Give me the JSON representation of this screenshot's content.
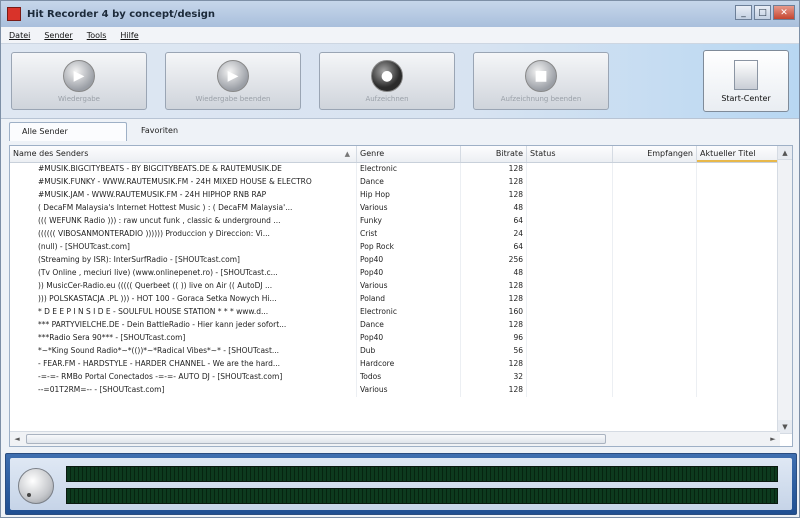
{
  "window": {
    "title": "Hit Recorder 4 by concept/design"
  },
  "window_buttons": {
    "minimize": "_",
    "maximize": "□",
    "close": "✕"
  },
  "menu": [
    "Datei",
    "Sender",
    "Tools",
    "Hilfe"
  ],
  "toolbar": {
    "play_label": "Wiedergabe",
    "stop_play_label": "Wiedergabe beenden",
    "record_label": "Aufzeichnen",
    "stop_record_label": "Aufzeichnung beenden",
    "start_center_label": "Start-Center"
  },
  "tabs": [
    "Alle Sender",
    "Favoriten"
  ],
  "columns": {
    "name": "Name des Senders",
    "genre": "Genre",
    "bitrate": "Bitrate",
    "status": "Status",
    "received": "Empfangen",
    "current_title": "Aktueller Titel"
  },
  "stations": [
    {
      "name": "#MUSIK.BIGCITYBEATS - BY BIGCITYBEATS.DE & RAUTEMUSIK.DE",
      "genre": "Electronic",
      "bitrate": "128"
    },
    {
      "name": "#MUSIK.FUNKY - WWW.RAUTEMUSIK.FM - 24H MIXED HOUSE & ELECTRO",
      "genre": "Dance",
      "bitrate": "128"
    },
    {
      "name": "#MUSIK.JAM - WWW.RAUTEMUSIK.FM - 24H HIPHOP RNB RAP",
      "genre": "Hip Hop",
      "bitrate": "128"
    },
    {
      "name": "( DecaFM Malaysia's Internet Hottest Music ) : ( DecaFM Malaysia'...",
      "genre": "Various",
      "bitrate": "48"
    },
    {
      "name": "((( WEFUNK Radio ))) : raw uncut funk , classic & underground ...",
      "genre": "Funky",
      "bitrate": "64"
    },
    {
      "name": "(((((( VIBOSANMONTERADIO )))))) Produccion y Direccion: Vi...",
      "genre": "Crist",
      "bitrate": "24"
    },
    {
      "name": "(null) - [SHOUTcast.com]",
      "genre": "Pop Rock",
      "bitrate": "64"
    },
    {
      "name": "(Streaming by ISR): InterSurfRadio - [SHOUTcast.com]",
      "genre": "Pop40",
      "bitrate": "256"
    },
    {
      "name": "(Tv Online , meciuri live) (www.onlinepenet.ro) - [SHOUTcast.c...",
      "genre": "Pop40",
      "bitrate": "48"
    },
    {
      "name": ")) MusicCer-Radio.eu ((((( Querbeet (( )) live on Air (( AutoDJ ...",
      "genre": "Various",
      "bitrate": "128"
    },
    {
      "name": "))) POLSKASTACJA .PL ))) - HOT 100 - Goraca Setka Nowych Hi...",
      "genre": "Poland",
      "bitrate": "128"
    },
    {
      "name": "* D E E P I N S I D E - SOULFUL HOUSE STATION * * * www.d...",
      "genre": "Electronic",
      "bitrate": "160"
    },
    {
      "name": "*** PARTYVIELCHE.DE - Dein BattleRadio - Hier kann jeder sofort...",
      "genre": "Dance",
      "bitrate": "128"
    },
    {
      "name": "***Radio Sera 90*** - [SHOUTcast.com]",
      "genre": "Pop40",
      "bitrate": "96"
    },
    {
      "name": "*~*King Sound Radio*~*(())*~*Radical Vibes*~* - [SHOUTcast...",
      "genre": "Dub",
      "bitrate": "56"
    },
    {
      "name": "- FEAR.FM - HARDSTYLE - HARDER CHANNEL - We are the hard...",
      "genre": "Hardcore",
      "bitrate": "128"
    },
    {
      "name": "-=-=- RMBo Portal Conectados -=-=- AUTO DJ - [SHOUTcast.com]",
      "genre": "Todos",
      "bitrate": "32"
    },
    {
      "name": "--=01T2RM=-- - [SHOUTcast.com]",
      "genre": "Various",
      "bitrate": "128"
    }
  ],
  "vu_meter": {
    "left_level": 0,
    "right_level": 0
  },
  "scroll_glyphs": {
    "up": "▲",
    "down": "▼",
    "left": "◄",
    "right": "►",
    "sort": "▲"
  }
}
